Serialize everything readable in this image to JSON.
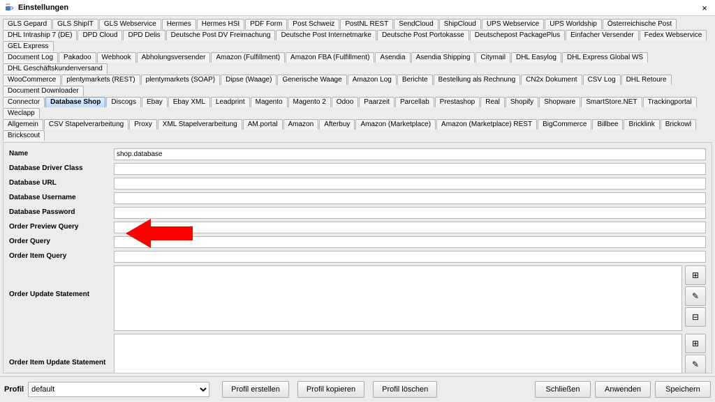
{
  "window": {
    "title": "Einstellungen",
    "close": "×"
  },
  "tabs": {
    "rows": [
      [
        "GLS Gepard",
        "GLS ShipIT",
        "GLS Webservice",
        "Hermes",
        "Hermes HSI",
        "PDF Form",
        "Post Schweiz",
        "PostNL REST",
        "SendCloud",
        "ShipCloud",
        "UPS Webservice",
        "UPS Worldship",
        "Österreichische Post"
      ],
      [
        "DHL Intraship 7 (DE)",
        "DPD Cloud",
        "DPD Delis",
        "Deutsche Post DV Freimachung",
        "Deutsche Post Internetmarke",
        "Deutsche Post Portokasse",
        "Deutschepost PackagePlus",
        "Einfacher Versender",
        "Fedex Webservice",
        "GEL Express"
      ],
      [
        "Document Log",
        "Pakadoo",
        "Webhook",
        "Abholungsversender",
        "Amazon (Fulfillment)",
        "Amazon FBA (Fulfillment)",
        "Asendia",
        "Asendia Shipping",
        "Citymail",
        "DHL Easylog",
        "DHL Express Global WS",
        "DHL Geschäftskundenversand"
      ],
      [
        "WooCommerce",
        "plentymarkets (REST)",
        "plentymarkets (SOAP)",
        "Dipse (Waage)",
        "Generische Waage",
        "Amazon Log",
        "Berichte",
        "Bestellung als Rechnung",
        "CN2x Dokument",
        "CSV Log",
        "DHL Retoure",
        "Document Downloader"
      ],
      [
        "Connector",
        "Database Shop",
        "Discogs",
        "Ebay",
        "Ebay XML",
        "Leadprint",
        "Magento",
        "Magento 2",
        "Odoo",
        "Paarzeit",
        "Parcellab",
        "Prestashop",
        "Real",
        "Shopify",
        "Shopware",
        "SmartStore.NET",
        "Trackingportal",
        "Weclapp"
      ],
      [
        "Allgemein",
        "CSV Stapelverarbeitung",
        "Proxy",
        "XML Stapelverarbeitung",
        "AM.portal",
        "Amazon",
        "Afterbuy",
        "Amazon (Marketplace)",
        "Amazon (Marketplace) REST",
        "BigCommerce",
        "Billbee",
        "Bricklink",
        "Brickowl",
        "Brickscout"
      ]
    ],
    "active": "Database Shop"
  },
  "form": {
    "name": {
      "label": "Name",
      "value": "shop.database"
    },
    "driver": {
      "label": "Database Driver Class",
      "value": ""
    },
    "url": {
      "label": "Database URL",
      "value": ""
    },
    "user": {
      "label": "Database Username",
      "value": ""
    },
    "pass": {
      "label": "Database Password",
      "value": ""
    },
    "preview": {
      "label": "Order Preview Query",
      "value": ""
    },
    "orderq": {
      "label": "Order Query",
      "value": ""
    },
    "itemq": {
      "label": "Order Item Query",
      "value": ""
    },
    "updstmt": {
      "label": "Order Update Statement",
      "value": ""
    },
    "itemupdstmt": {
      "label": "Order Item Update Statement",
      "value": ""
    }
  },
  "sideBtn": {
    "add": "⊞",
    "edit": "✎",
    "remove": "⊟"
  },
  "bottom": {
    "profileLabel": "Profil",
    "profileValue": "default",
    "createProfile": "Profil erstellen",
    "copyProfile": "Profil kopieren",
    "deleteProfile": "Profil löschen",
    "close": "Schließen",
    "apply": "Anwenden",
    "save": "Speichern"
  }
}
